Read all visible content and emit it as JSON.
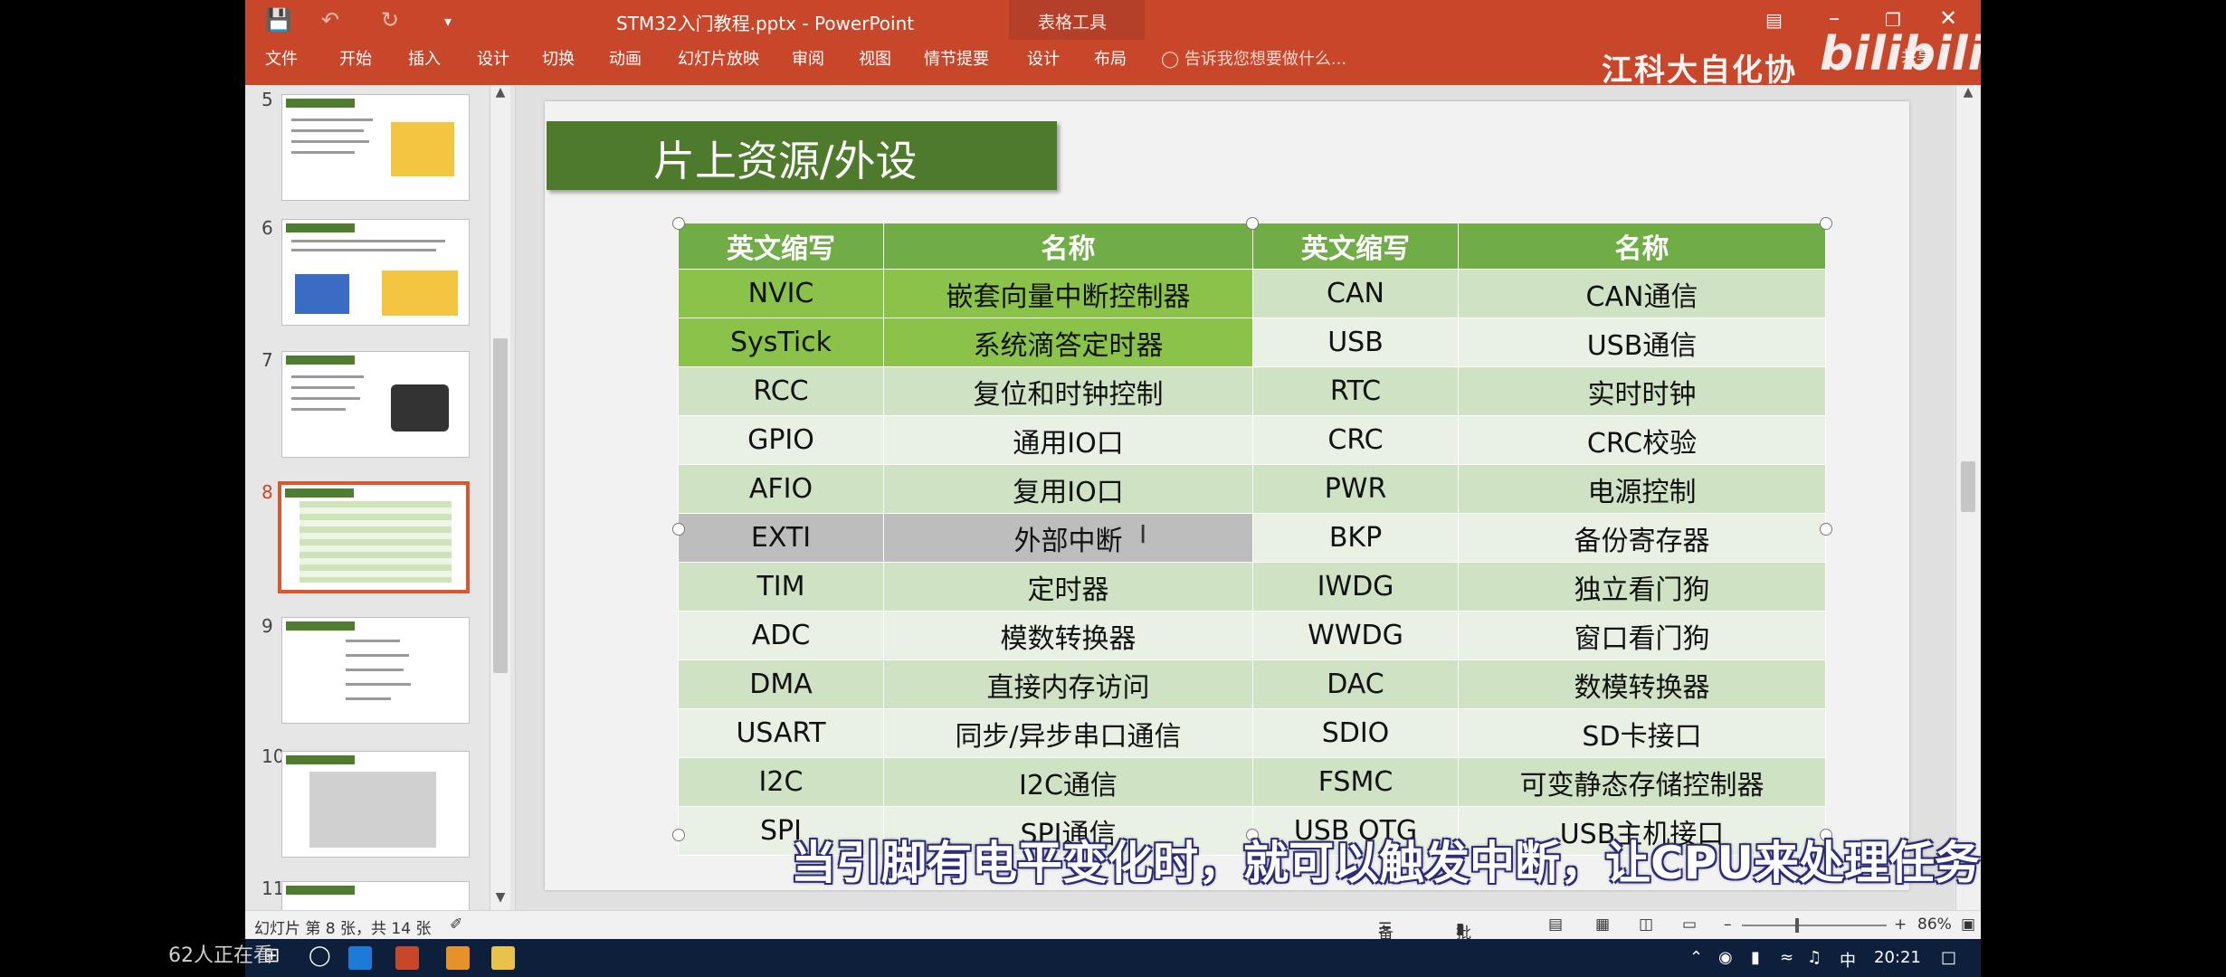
{
  "window": {
    "document_title": "STM32入门教程.pptx - PowerPoint",
    "context_group": "表格工具",
    "qat": [
      "save-icon",
      "undo-icon",
      "redo-icon",
      "customize-icon"
    ]
  },
  "ribbon": {
    "tabs": [
      "文件",
      "开始",
      "插入",
      "设计",
      "切换",
      "动画",
      "幻灯片放映",
      "审阅",
      "视图",
      "情节提要",
      "设计",
      "布局"
    ],
    "tell_me": "告诉我您想要做什么...",
    "share": "共享"
  },
  "overlay": {
    "channel": "江科大自化协",
    "logo": "bilibili",
    "subtitle": "当引脚有电平变化时，就可以触发中断，让CPU来处理任务",
    "viewers": "62人正在看"
  },
  "thumbnails": [
    {
      "num": "5",
      "active": false
    },
    {
      "num": "6",
      "active": false
    },
    {
      "num": "7",
      "active": false
    },
    {
      "num": "8",
      "active": true
    },
    {
      "num": "9",
      "active": false
    },
    {
      "num": "10",
      "active": false
    },
    {
      "num": "11",
      "active": false
    }
  ],
  "slide": {
    "title": "片上资源/外设",
    "headers": [
      "英文缩写",
      "名称",
      "英文缩写",
      "名称"
    ],
    "rows": [
      [
        "NVIC",
        "嵌套向量中断控制器",
        "CAN",
        "CAN通信"
      ],
      [
        "SysTick",
        "系统滴答定时器",
        "USB",
        "USB通信"
      ],
      [
        "RCC",
        "复位和时钟控制",
        "RTC",
        "实时时钟"
      ],
      [
        "GPIO",
        "通用IO口",
        "CRC",
        "CRC校验"
      ],
      [
        "AFIO",
        "复用IO口",
        "PWR",
        "电源控制"
      ],
      [
        "EXTI",
        "外部中断",
        "BKP",
        "备份寄存器"
      ],
      [
        "TIM",
        "定时器",
        "IWDG",
        "独立看门狗"
      ],
      [
        "ADC",
        "模数转换器",
        "WWDG",
        "窗口看门狗"
      ],
      [
        "DMA",
        "直接内存访问",
        "DAC",
        "数模转换器"
      ],
      [
        "USART",
        "同步/异步串口通信",
        "SDIO",
        "SD卡接口"
      ],
      [
        "I2C",
        "I2C通信",
        "FSMC",
        "可变静态存储控制器"
      ],
      [
        "SPI",
        "SPI通信",
        "USB OTG",
        "USB主机接口"
      ]
    ]
  },
  "status": {
    "slide_info": "幻灯片 第 8 张，共 14 张",
    "notes": "备注",
    "comments": "批注",
    "zoom": "86%"
  },
  "taskbar": {
    "ime": "中",
    "time": "20:21"
  }
}
